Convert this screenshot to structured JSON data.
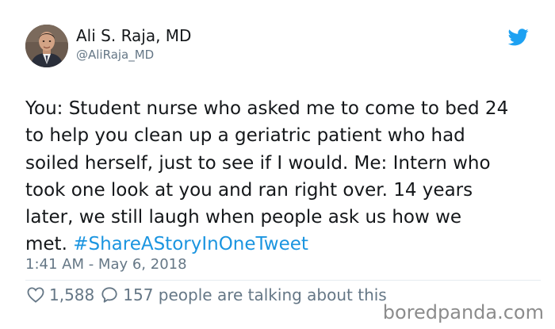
{
  "author": {
    "display_name": "Ali S. Raja, MD",
    "handle": "@AliRaja_MD",
    "avatar_icon": "profile-photo"
  },
  "tweet": {
    "lines": [
      "You: Student nurse who asked me to come to bed 24",
      "to help you clean up a geriatric patient who had",
      "soiled herself, just to see if I would. Me: Intern who",
      "took one look at you and ran right over. 14 years",
      "later, we still laugh when people ask us how we",
      "met."
    ],
    "hashtag": "#ShareAStoryInOneTweet",
    "timestamp": "1:41 AM - May 6, 2018"
  },
  "actions": {
    "likes": "1,588",
    "talking": "157 people are talking about this"
  },
  "watermark": "boredpanda.com",
  "colors": {
    "text": "#14171a",
    "secondary": "#657786",
    "link": "#1b95e0",
    "twitter_blue": "#1da1f2",
    "divider": "#e6ecf0",
    "watermark": "#8c8c8c"
  }
}
